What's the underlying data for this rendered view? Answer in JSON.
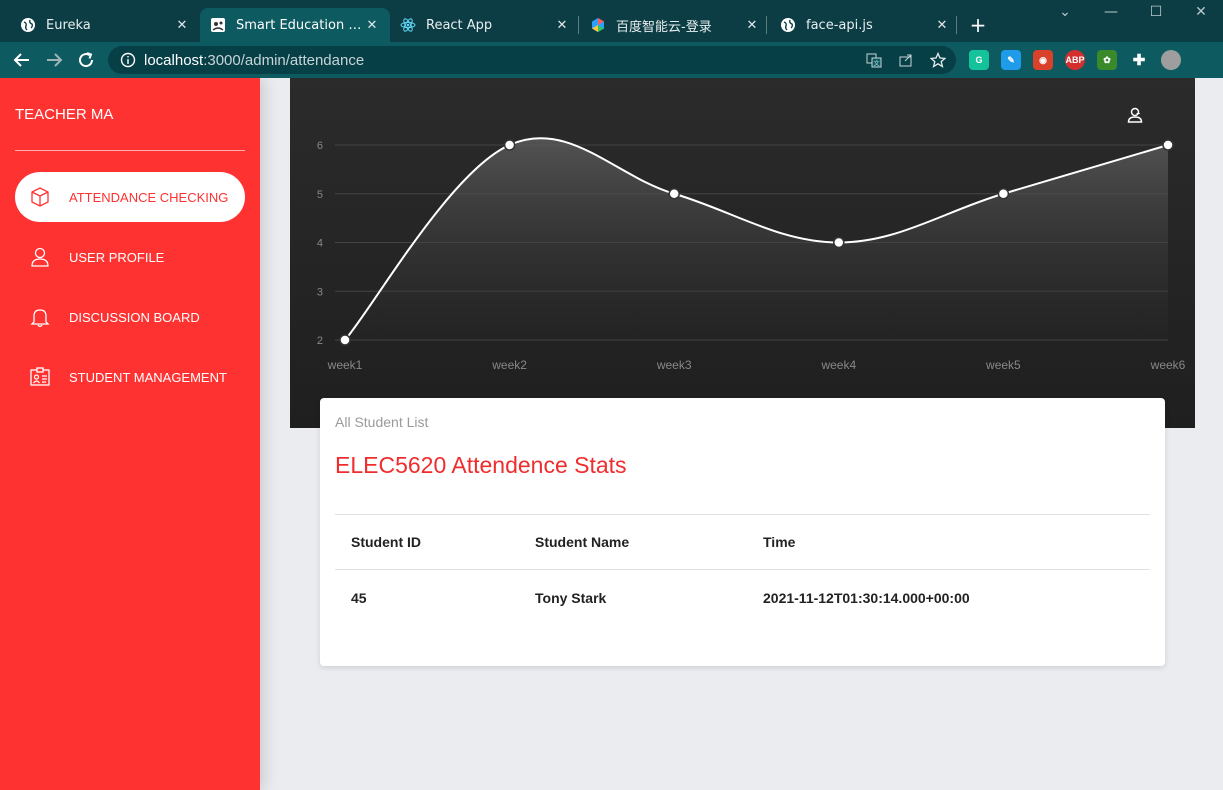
{
  "browser": {
    "tabs": [
      {
        "title": "Eureka",
        "icon": "globe-icon"
      },
      {
        "title": "Smart Education System",
        "icon": "app-icon",
        "active": true
      },
      {
        "title": "React App",
        "icon": "react-icon"
      },
      {
        "title": "百度智能云-登录",
        "icon": "baidu-cloud-icon"
      },
      {
        "title": "face-api.js",
        "icon": "globe-icon"
      }
    ],
    "tab_close": "✕",
    "new_tab": "+",
    "url_host": "localhost",
    "url_path": ":3000/admin/attendance",
    "window_controls": {
      "dropdown": "⌄",
      "minimize": "—",
      "maximize": "☐",
      "close": "✕"
    },
    "extensions": [
      {
        "name": "grammarly-icon",
        "label": "G",
        "color": "#15c39a"
      },
      {
        "name": "pen-extension-icon",
        "label": "✎",
        "color": "#1e9be9"
      },
      {
        "name": "red-extension-icon",
        "label": "◉",
        "color": "#d9412b"
      },
      {
        "name": "adblock-icon",
        "label": "ABP",
        "color": "#d32f2f"
      },
      {
        "name": "leaf-extension-icon",
        "label": "✿",
        "color": "#3a8a2c"
      },
      {
        "name": "puzzle-icon",
        "label": "✚",
        "color": "transparent"
      },
      {
        "name": "profile-avatar",
        "label": "",
        "color": "#9e9e9e"
      }
    ]
  },
  "sidebar": {
    "brand": "TEACHER MA",
    "items": [
      {
        "label": "ATTENDANCE CHECKING",
        "icon": "box-icon",
        "active": true
      },
      {
        "label": "USER PROFILE",
        "icon": "user-icon"
      },
      {
        "label": "DISCUSSION BOARD",
        "icon": "bell-icon"
      },
      {
        "label": "STUDENT MANAGEMENT",
        "icon": "id-card-icon"
      }
    ],
    "accent_color": "#ff3232"
  },
  "header": {
    "user_menu_caret": "-"
  },
  "chart_data": {
    "type": "line",
    "categories": [
      "week1",
      "week2",
      "week3",
      "week4",
      "week5",
      "week6"
    ],
    "values": [
      2,
      6,
      5,
      4,
      5,
      6
    ],
    "y_ticks": [
      "2",
      "3",
      "4",
      "5",
      "6"
    ],
    "ylim": [
      2,
      6
    ],
    "grid": true,
    "line_color": "#ffffff"
  },
  "card": {
    "subtitle": "All Student List",
    "title": "ELEC5620 Attendence Stats",
    "columns": [
      "Student ID",
      "Student Name",
      "Time"
    ],
    "rows": [
      [
        "45",
        "Tony Stark",
        "2021-11-12T01:30:14.000+00:00"
      ]
    ]
  }
}
